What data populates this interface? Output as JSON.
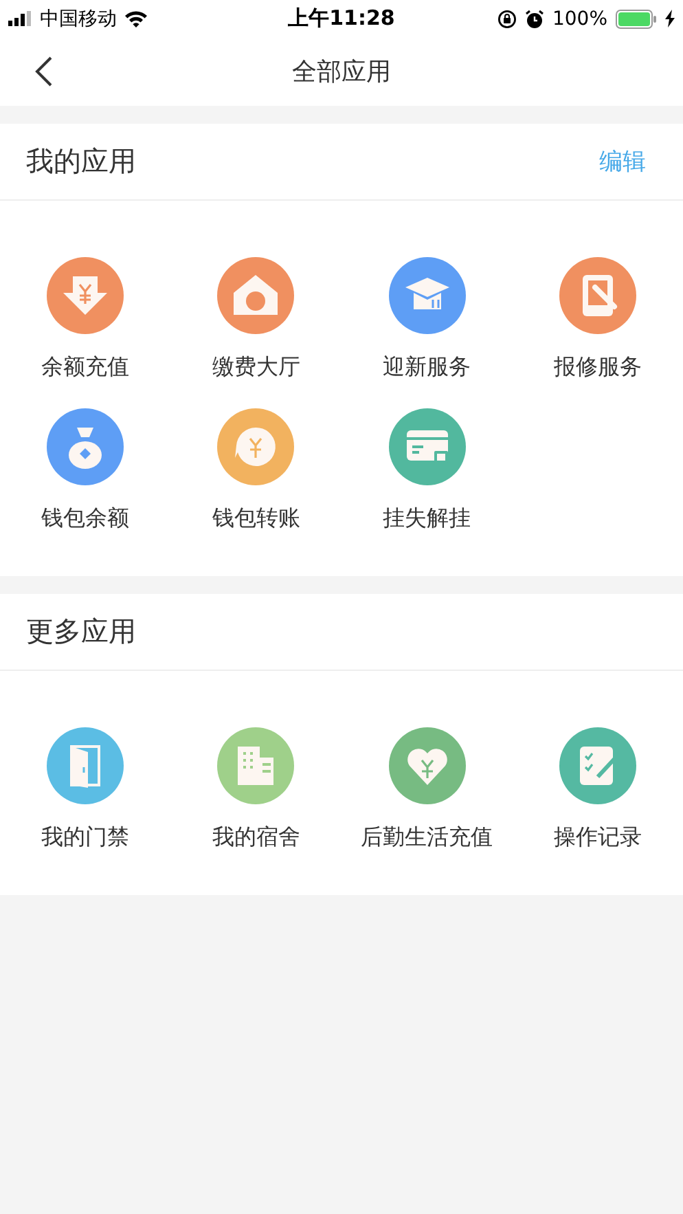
{
  "status_bar": {
    "carrier": "中国移动",
    "time": "上午11:28",
    "battery": "100%"
  },
  "nav": {
    "title": "全部应用"
  },
  "sections": [
    {
      "title": "我的应用",
      "action": "编辑",
      "apps": [
        {
          "label": "余额充值",
          "kind": "download",
          "color": "#f09060"
        },
        {
          "label": "缴费大厅",
          "kind": "house",
          "color": "#f09060"
        },
        {
          "label": "迎新服务",
          "kind": "cap",
          "color": "#5e9ef5"
        },
        {
          "label": "报修服务",
          "kind": "repair",
          "color": "#f09060"
        },
        {
          "label": "钱包余额",
          "kind": "bag",
          "color": "#5e9ef5"
        },
        {
          "label": "钱包转账",
          "kind": "transfer",
          "color": "#f2b25f"
        },
        {
          "label": "挂失解挂",
          "kind": "card",
          "color": "#52b89e"
        }
      ]
    },
    {
      "title": "更多应用",
      "apps": [
        {
          "label": "我的门禁",
          "kind": "door",
          "color": "#5bbde4"
        },
        {
          "label": "我的宿舍",
          "kind": "building",
          "color": "#9fd08a"
        },
        {
          "label": "后勤生活充值",
          "kind": "heart",
          "color": "#77bb82"
        },
        {
          "label": "操作记录",
          "kind": "notes",
          "color": "#55b9a2"
        }
      ]
    }
  ]
}
